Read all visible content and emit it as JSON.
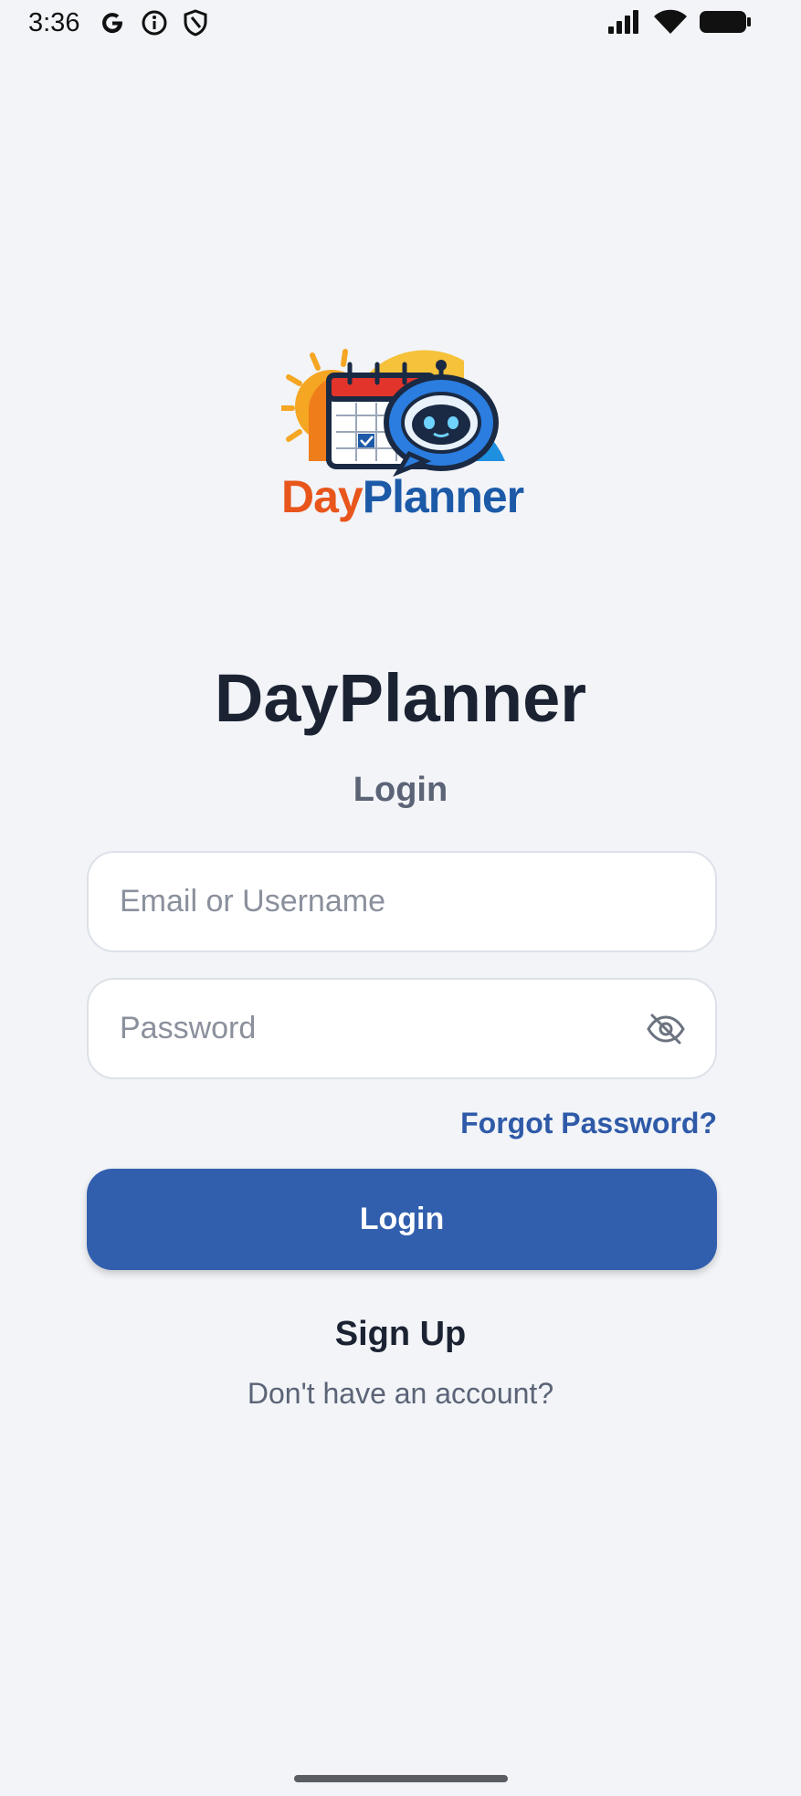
{
  "status_bar": {
    "time": "3:36",
    "icons_left": [
      "google-icon",
      "info-icon",
      "shield-icon"
    ],
    "icons_right": [
      "signal-icon",
      "wifi-icon",
      "battery-icon"
    ]
  },
  "logo": {
    "text_day": "Day",
    "text_planner": "Planner",
    "icons": [
      "calendar-icon",
      "robot-chat-icon",
      "sun-icon"
    ]
  },
  "title": "DayPlanner",
  "subtitle": "Login",
  "form": {
    "email_placeholder": "Email or Username",
    "email_value": "",
    "password_placeholder": "Password",
    "password_value": "",
    "forgot_label": "Forgot Password?",
    "login_label": "Login"
  },
  "signup": {
    "label": "Sign Up",
    "hint": "Don't have an account?"
  },
  "colors": {
    "background": "#f2f4f8",
    "primary": "#315fad",
    "link": "#2f5aa8",
    "title": "#1b2333",
    "muted": "#5b6476"
  }
}
